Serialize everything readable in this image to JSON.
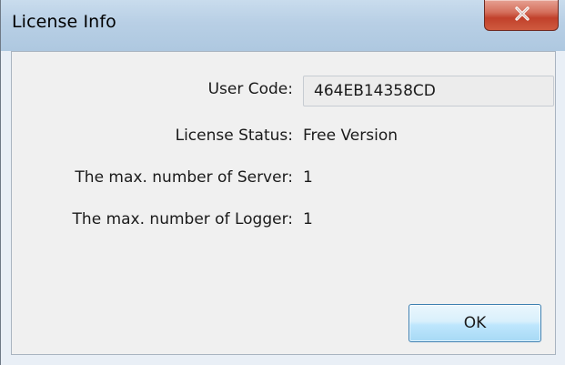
{
  "window": {
    "title": "License Info",
    "close_icon": "close-x-icon"
  },
  "fields": {
    "user_code_label": "User Code:",
    "user_code_value": "464EB14358CD",
    "license_status_label": "License Status:",
    "license_status_value": "Free Version",
    "max_server_label": "The max. number of Server:",
    "max_server_value": "1",
    "max_logger_label": "The max. number of Logger:",
    "max_logger_value": "1"
  },
  "buttons": {
    "ok_label": "OK"
  },
  "colors": {
    "close_button": "#c9503a",
    "ok_button_border": "#3c7fb1"
  }
}
